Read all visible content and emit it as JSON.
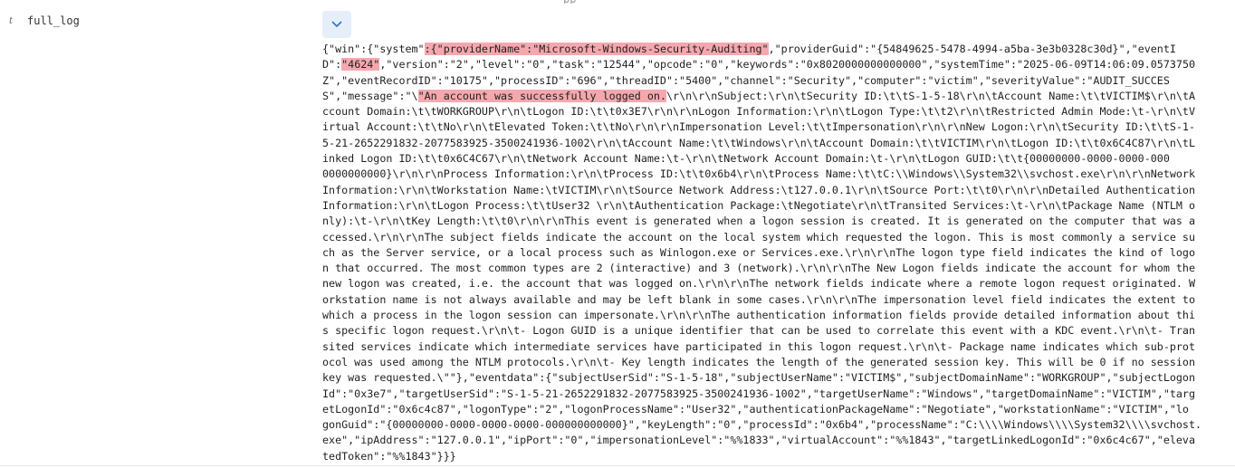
{
  "header": {
    "partial_title": "pp"
  },
  "field": {
    "type_label": "t",
    "name": "full_log",
    "expand_icon": "chevron-down-icon"
  },
  "accent_color": "#e6eef9",
  "highlight_color": "#f4a8ae",
  "log_lines": [
    [
      {
        "t": "{\"win\":{\"system\""
      },
      {
        "t": ":{\"providerName\":\"Microsoft-Windows-Security-Auditing\"",
        "h": true
      },
      {
        "t": ",\"providerGuid\":\"{54849625-5478-4994-a5ba-3e3b0328c30d}\",\"eventI"
      }
    ],
    [
      {
        "t": "D\":"
      },
      {
        "t": "\"4624\"",
        "h": true
      },
      {
        "t": ",\"version\":\"2\",\"level\":\"0\",\"task\":\"12544\",\"opcode\":\"0\",\"keywords\":\"0x8020000000000000\",\"systemTime\":\"2025-06-09T14:06:09.0573750"
      }
    ],
    [
      {
        "t": "Z\",\"eventRecordID\":\"10175\",\"processID\":\"696\",\"threadID\":\"5400\",\"channel\":\"Security\",\"computer\":\"victim\",\"severityValue\":\"AUDIT_SUCCES"
      }
    ],
    [
      {
        "t": "S\",\"message\":\"\\"
      },
      {
        "t": "\"An account was successfully logged on.",
        "h": true
      },
      {
        "t": "\\r\\n\\r\\nSubject:\\r\\n\\tSecurity ID:\\t\\tS-1-5-18\\r\\n\\tAccount Name:\\t\\tVICTIM$\\r\\n\\tA"
      }
    ],
    [
      {
        "t": "ccount Domain:\\t\\tWORKGROUP\\r\\n\\tLogon ID:\\t\\t0x3E7\\r\\n\\r\\nLogon Information:\\r\\n\\tLogon Type:\\t\\t2\\r\\n\\tRestricted Admin Mode:\\t-\\r\\n\\tV"
      }
    ],
    [
      {
        "t": "irtual Account:\\t\\tNo\\r\\n\\tElevated Token:\\t\\tNo\\r\\n\\r\\nImpersonation Level:\\t\\tImpersonation\\r\\n\\r\\nNew Logon:\\r\\n\\tSecurity ID:\\t\\tS-1-"
      }
    ],
    [
      {
        "t": "5-21-2652291832-2077583925-3500241936-1002\\r\\n\\tAccount Name:\\t\\tWindows\\r\\n\\tAccount Domain:\\t\\tVICTIM\\r\\n\\tLogon ID:\\t\\t0x6C4C87\\r\\n\\tL"
      }
    ],
    [
      {
        "t": "inked Logon ID:\\t\\t0x6C4C67\\r\\n\\tNetwork Account Name:\\t-\\r\\n\\tNetwork Account Domain:\\t-\\r\\n\\tLogon GUID:\\t\\t{00000000-0000-0000-000"
      }
    ],
    [
      {
        "t": "0000000000}\\r\\n\\r\\nProcess Information:\\r\\n\\tProcess ID:\\t\\t0x6b4\\r\\n\\tProcess Name:\\t\\tC:\\\\Windows\\\\System32\\\\svchost.exe\\r\\n\\r\\nNetwork"
      }
    ],
    [
      {
        "t": "Information:\\r\\n\\tWorkstation Name:\\tVICTIM\\r\\n\\tSource Network Address:\\t127.0.0.1\\r\\n\\tSource Port:\\t\\t0\\r\\n\\r\\nDetailed Authentication"
      }
    ],
    [
      {
        "t": "Information:\\r\\n\\tLogon Process:\\t\\tUser32 \\r\\n\\tAuthentication Package:\\tNegotiate\\r\\n\\tTransited Services:\\t-\\r\\n\\tPackage Name (NTLM o"
      }
    ],
    [
      {
        "t": "nly):\\t-\\r\\n\\tKey Length:\\t\\t0\\r\\n\\r\\nThis event is generated when a logon session is created. It is generated on the computer that was a"
      }
    ],
    [
      {
        "t": "ccessed.\\r\\n\\r\\nThe subject fields indicate the account on the local system which requested the logon. This is most commonly a service su"
      }
    ],
    [
      {
        "t": "ch as the Server service, or a local process such as Winlogon.exe or Services.exe.\\r\\n\\r\\nThe logon type field indicates the kind of logo"
      }
    ],
    [
      {
        "t": "n that occurred. The most common types are 2 (interactive) and 3 (network).\\r\\n\\r\\nThe New Logon fields indicate the account for whom the"
      }
    ],
    [
      {
        "t": "new logon was created, i.e. the account that was logged on.\\r\\n\\r\\nThe network fields indicate where a remote logon request originated. W"
      }
    ],
    [
      {
        "t": "orkstation name is not always available and may be left blank in some cases.\\r\\n\\r\\nThe impersonation level field indicates the extent to"
      }
    ],
    [
      {
        "t": "which a process in the logon session can impersonate.\\r\\n\\r\\nThe authentication information fields provide detailed information about thi"
      }
    ],
    [
      {
        "t": "s specific logon request.\\r\\n\\t- Logon GUID is a unique identifier that can be used to correlate this event with a KDC event.\\r\\n\\t- Tran"
      }
    ],
    [
      {
        "t": "sited services indicate which intermediate services have participated in this logon request.\\r\\n\\t- Package name indicates which sub-prot"
      }
    ],
    [
      {
        "t": "ocol was used among the NTLM protocols.\\r\\n\\t- Key length indicates the length of the generated session key. This will be 0 if no session"
      }
    ],
    [
      {
        "t": "key was requested.\\\"\"},\"eventdata\":{\"subjectUserSid\":\"S-1-5-18\",\"subjectUserName\":\"VICTIM$\",\"subjectDomainName\":\"WORKGROUP\",\"subjectLogon"
      }
    ],
    [
      {
        "t": "Id\":\"0x3e7\",\"targetUserSid\":\"S-1-5-21-2652291832-2077583925-3500241936-1002\",\"targetUserName\":\"Windows\",\"targetDomainName\":\"VICTIM\",\"targ"
      }
    ],
    [
      {
        "t": "etLogonId\":\"0x6c4c87\",\"logonType\":\"2\",\"logonProcessName\":\"User32\",\"authenticationPackageName\":\"Negotiate\",\"workstationName\":\"VICTIM\",\"lo"
      }
    ],
    [
      {
        "t": "gonGuid\":\"{00000000-0000-0000-0000-000000000000}\",\"keyLength\":\"0\",\"processId\":\"0x6b4\",\"processName\":\"C:\\\\\\\\Windows\\\\\\\\System32\\\\\\\\svchost."
      }
    ],
    [
      {
        "t": "exe\",\"ipAddress\":\"127.0.0.1\",\"ipPort\":\"0\",\"impersonationLevel\":\"%%1833\",\"virtualAccount\":\"%%1843\",\"targetLinkedLogonId\":\"0x6c4c67\",\"eleva"
      }
    ],
    [
      {
        "t": "tedToken\":\"%%1843\"}}}"
      }
    ]
  ]
}
